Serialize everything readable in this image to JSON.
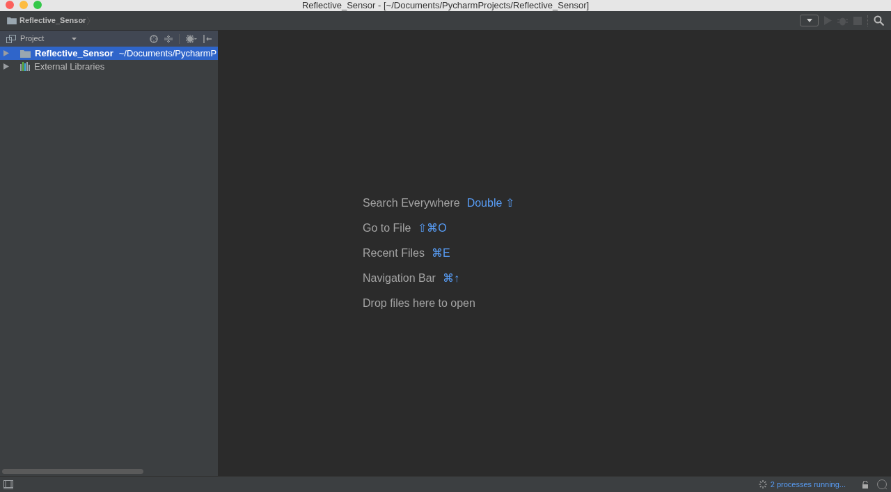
{
  "window": {
    "title": "Reflective_Sensor - [~/Documents/PycharmProjects/Reflective_Sensor]"
  },
  "breadcrumb": "Reflective_Sensor",
  "project_panel": {
    "view": "Project",
    "tree": [
      {
        "kind": "folder",
        "label": "Reflective_Sensor",
        "path": "~/Documents/PycharmP",
        "selected": true,
        "expanded": false
      },
      {
        "kind": "library",
        "label": "External Libraries",
        "selected": false,
        "expanded": false
      }
    ]
  },
  "hints": [
    {
      "label": "Search Everywhere",
      "shortcut": "Double ⇧"
    },
    {
      "label": "Go to File",
      "shortcut": "⇧⌘O"
    },
    {
      "label": "Recent Files",
      "shortcut": "⌘E"
    },
    {
      "label": "Navigation Bar",
      "shortcut": "⌘↑"
    },
    {
      "label": "Drop files here to open"
    }
  ],
  "status_bar": {
    "processes": "2 processes running..."
  }
}
